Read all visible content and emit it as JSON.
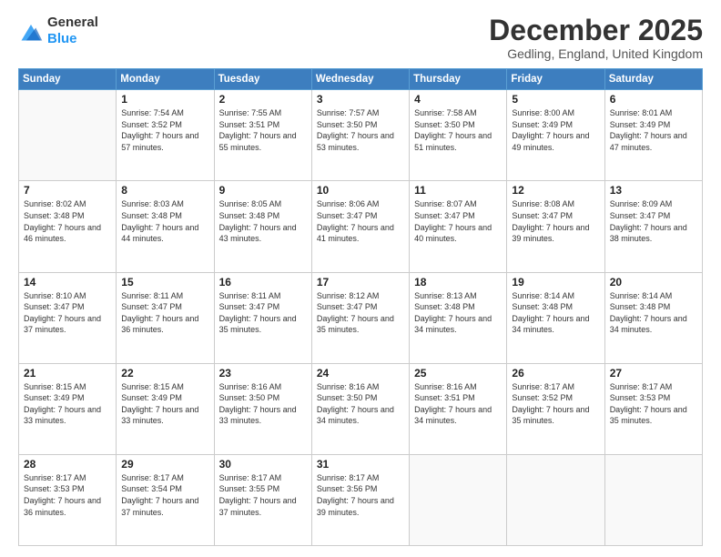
{
  "logo": {
    "line1": "General",
    "line2": "Blue"
  },
  "header": {
    "title": "December 2025",
    "subtitle": "Gedling, England, United Kingdom"
  },
  "weekdays": [
    "Sunday",
    "Monday",
    "Tuesday",
    "Wednesday",
    "Thursday",
    "Friday",
    "Saturday"
  ],
  "weeks": [
    [
      {
        "day": "",
        "sunrise": "",
        "sunset": "",
        "daylight": ""
      },
      {
        "day": "1",
        "sunrise": "Sunrise: 7:54 AM",
        "sunset": "Sunset: 3:52 PM",
        "daylight": "Daylight: 7 hours and 57 minutes."
      },
      {
        "day": "2",
        "sunrise": "Sunrise: 7:55 AM",
        "sunset": "Sunset: 3:51 PM",
        "daylight": "Daylight: 7 hours and 55 minutes."
      },
      {
        "day": "3",
        "sunrise": "Sunrise: 7:57 AM",
        "sunset": "Sunset: 3:50 PM",
        "daylight": "Daylight: 7 hours and 53 minutes."
      },
      {
        "day": "4",
        "sunrise": "Sunrise: 7:58 AM",
        "sunset": "Sunset: 3:50 PM",
        "daylight": "Daylight: 7 hours and 51 minutes."
      },
      {
        "day": "5",
        "sunrise": "Sunrise: 8:00 AM",
        "sunset": "Sunset: 3:49 PM",
        "daylight": "Daylight: 7 hours and 49 minutes."
      },
      {
        "day": "6",
        "sunrise": "Sunrise: 8:01 AM",
        "sunset": "Sunset: 3:49 PM",
        "daylight": "Daylight: 7 hours and 47 minutes."
      }
    ],
    [
      {
        "day": "7",
        "sunrise": "Sunrise: 8:02 AM",
        "sunset": "Sunset: 3:48 PM",
        "daylight": "Daylight: 7 hours and 46 minutes."
      },
      {
        "day": "8",
        "sunrise": "Sunrise: 8:03 AM",
        "sunset": "Sunset: 3:48 PM",
        "daylight": "Daylight: 7 hours and 44 minutes."
      },
      {
        "day": "9",
        "sunrise": "Sunrise: 8:05 AM",
        "sunset": "Sunset: 3:48 PM",
        "daylight": "Daylight: 7 hours and 43 minutes."
      },
      {
        "day": "10",
        "sunrise": "Sunrise: 8:06 AM",
        "sunset": "Sunset: 3:47 PM",
        "daylight": "Daylight: 7 hours and 41 minutes."
      },
      {
        "day": "11",
        "sunrise": "Sunrise: 8:07 AM",
        "sunset": "Sunset: 3:47 PM",
        "daylight": "Daylight: 7 hours and 40 minutes."
      },
      {
        "day": "12",
        "sunrise": "Sunrise: 8:08 AM",
        "sunset": "Sunset: 3:47 PM",
        "daylight": "Daylight: 7 hours and 39 minutes."
      },
      {
        "day": "13",
        "sunrise": "Sunrise: 8:09 AM",
        "sunset": "Sunset: 3:47 PM",
        "daylight": "Daylight: 7 hours and 38 minutes."
      }
    ],
    [
      {
        "day": "14",
        "sunrise": "Sunrise: 8:10 AM",
        "sunset": "Sunset: 3:47 PM",
        "daylight": "Daylight: 7 hours and 37 minutes."
      },
      {
        "day": "15",
        "sunrise": "Sunrise: 8:11 AM",
        "sunset": "Sunset: 3:47 PM",
        "daylight": "Daylight: 7 hours and 36 minutes."
      },
      {
        "day": "16",
        "sunrise": "Sunrise: 8:11 AM",
        "sunset": "Sunset: 3:47 PM",
        "daylight": "Daylight: 7 hours and 35 minutes."
      },
      {
        "day": "17",
        "sunrise": "Sunrise: 8:12 AM",
        "sunset": "Sunset: 3:47 PM",
        "daylight": "Daylight: 7 hours and 35 minutes."
      },
      {
        "day": "18",
        "sunrise": "Sunrise: 8:13 AM",
        "sunset": "Sunset: 3:48 PM",
        "daylight": "Daylight: 7 hours and 34 minutes."
      },
      {
        "day": "19",
        "sunrise": "Sunrise: 8:14 AM",
        "sunset": "Sunset: 3:48 PM",
        "daylight": "Daylight: 7 hours and 34 minutes."
      },
      {
        "day": "20",
        "sunrise": "Sunrise: 8:14 AM",
        "sunset": "Sunset: 3:48 PM",
        "daylight": "Daylight: 7 hours and 34 minutes."
      }
    ],
    [
      {
        "day": "21",
        "sunrise": "Sunrise: 8:15 AM",
        "sunset": "Sunset: 3:49 PM",
        "daylight": "Daylight: 7 hours and 33 minutes."
      },
      {
        "day": "22",
        "sunrise": "Sunrise: 8:15 AM",
        "sunset": "Sunset: 3:49 PM",
        "daylight": "Daylight: 7 hours and 33 minutes."
      },
      {
        "day": "23",
        "sunrise": "Sunrise: 8:16 AM",
        "sunset": "Sunset: 3:50 PM",
        "daylight": "Daylight: 7 hours and 33 minutes."
      },
      {
        "day": "24",
        "sunrise": "Sunrise: 8:16 AM",
        "sunset": "Sunset: 3:50 PM",
        "daylight": "Daylight: 7 hours and 34 minutes."
      },
      {
        "day": "25",
        "sunrise": "Sunrise: 8:16 AM",
        "sunset": "Sunset: 3:51 PM",
        "daylight": "Daylight: 7 hours and 34 minutes."
      },
      {
        "day": "26",
        "sunrise": "Sunrise: 8:17 AM",
        "sunset": "Sunset: 3:52 PM",
        "daylight": "Daylight: 7 hours and 35 minutes."
      },
      {
        "day": "27",
        "sunrise": "Sunrise: 8:17 AM",
        "sunset": "Sunset: 3:53 PM",
        "daylight": "Daylight: 7 hours and 35 minutes."
      }
    ],
    [
      {
        "day": "28",
        "sunrise": "Sunrise: 8:17 AM",
        "sunset": "Sunset: 3:53 PM",
        "daylight": "Daylight: 7 hours and 36 minutes."
      },
      {
        "day": "29",
        "sunrise": "Sunrise: 8:17 AM",
        "sunset": "Sunset: 3:54 PM",
        "daylight": "Daylight: 7 hours and 37 minutes."
      },
      {
        "day": "30",
        "sunrise": "Sunrise: 8:17 AM",
        "sunset": "Sunset: 3:55 PM",
        "daylight": "Daylight: 7 hours and 37 minutes."
      },
      {
        "day": "31",
        "sunrise": "Sunrise: 8:17 AM",
        "sunset": "Sunset: 3:56 PM",
        "daylight": "Daylight: 7 hours and 39 minutes."
      },
      {
        "day": "",
        "sunrise": "",
        "sunset": "",
        "daylight": ""
      },
      {
        "day": "",
        "sunrise": "",
        "sunset": "",
        "daylight": ""
      },
      {
        "day": "",
        "sunrise": "",
        "sunset": "",
        "daylight": ""
      }
    ]
  ]
}
